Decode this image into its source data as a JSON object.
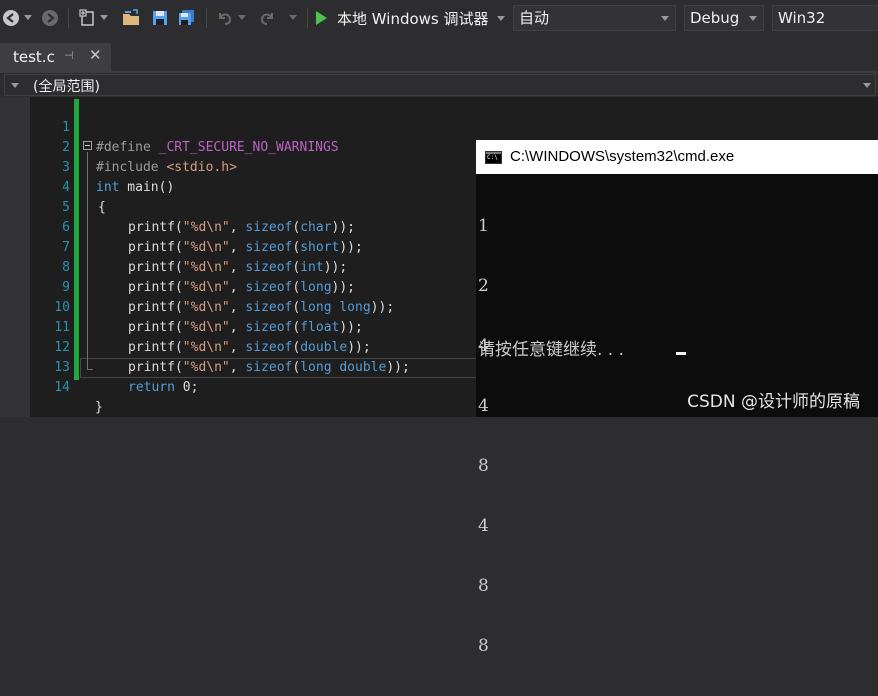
{
  "toolbar": {
    "icons": [
      "back-icon",
      "forward-icon",
      "new-item-icon",
      "open-folder-icon",
      "save-icon",
      "save-all-icon",
      "undo-icon",
      "redo-icon",
      "start-icon"
    ],
    "debugger_label": "本地 Windows 调试器",
    "solution_platform_auto": "自动",
    "configuration": "Debug",
    "platform": "Win32"
  },
  "tabs": [
    {
      "name": "test.c",
      "pin_glyph": "⊣",
      "close_glyph": "✕"
    }
  ],
  "scope_bar": {
    "label": "(全局范围)"
  },
  "editor": {
    "line_numbers": [
      "1",
      "2",
      "3",
      "4",
      "5",
      "6",
      "7",
      "8",
      "9",
      "10",
      "11",
      "12",
      "13",
      "14"
    ],
    "code": {
      "l1_directive": "#define",
      "l1_macro": "_CRT_SECURE_NO_WARNINGS",
      "l2_directive": "#include",
      "l2_header": "<stdio.h>",
      "l3_kw": "int",
      "l3_rest": " main()",
      "l4": "{",
      "printf_prefix": "printf(",
      "fmt": "\"%d\\n\"",
      "comma": ", ",
      "sizeof_kw": "sizeof",
      "types": [
        "char",
        "short",
        "int",
        "long",
        "long long",
        "float",
        "double",
        "long double"
      ],
      "suffix": "));",
      "l13_kw": "return",
      "l13_rest": " 0;",
      "l14": "}"
    },
    "accent_colors": {
      "keyword": "#569cd6",
      "string": "#d69d85",
      "macro": "#bd63c5",
      "line_number": "#2b91af",
      "change_bar": "#1fa83e"
    }
  },
  "console": {
    "title": "C:\\WINDOWS\\system32\\cmd.exe",
    "output_lines": [
      "1",
      "2",
      "4",
      "4",
      "8",
      "4",
      "8",
      "8"
    ],
    "prompt": "请按任意键继续. . ."
  },
  "watermark": "CSDN @设计师的原稿"
}
